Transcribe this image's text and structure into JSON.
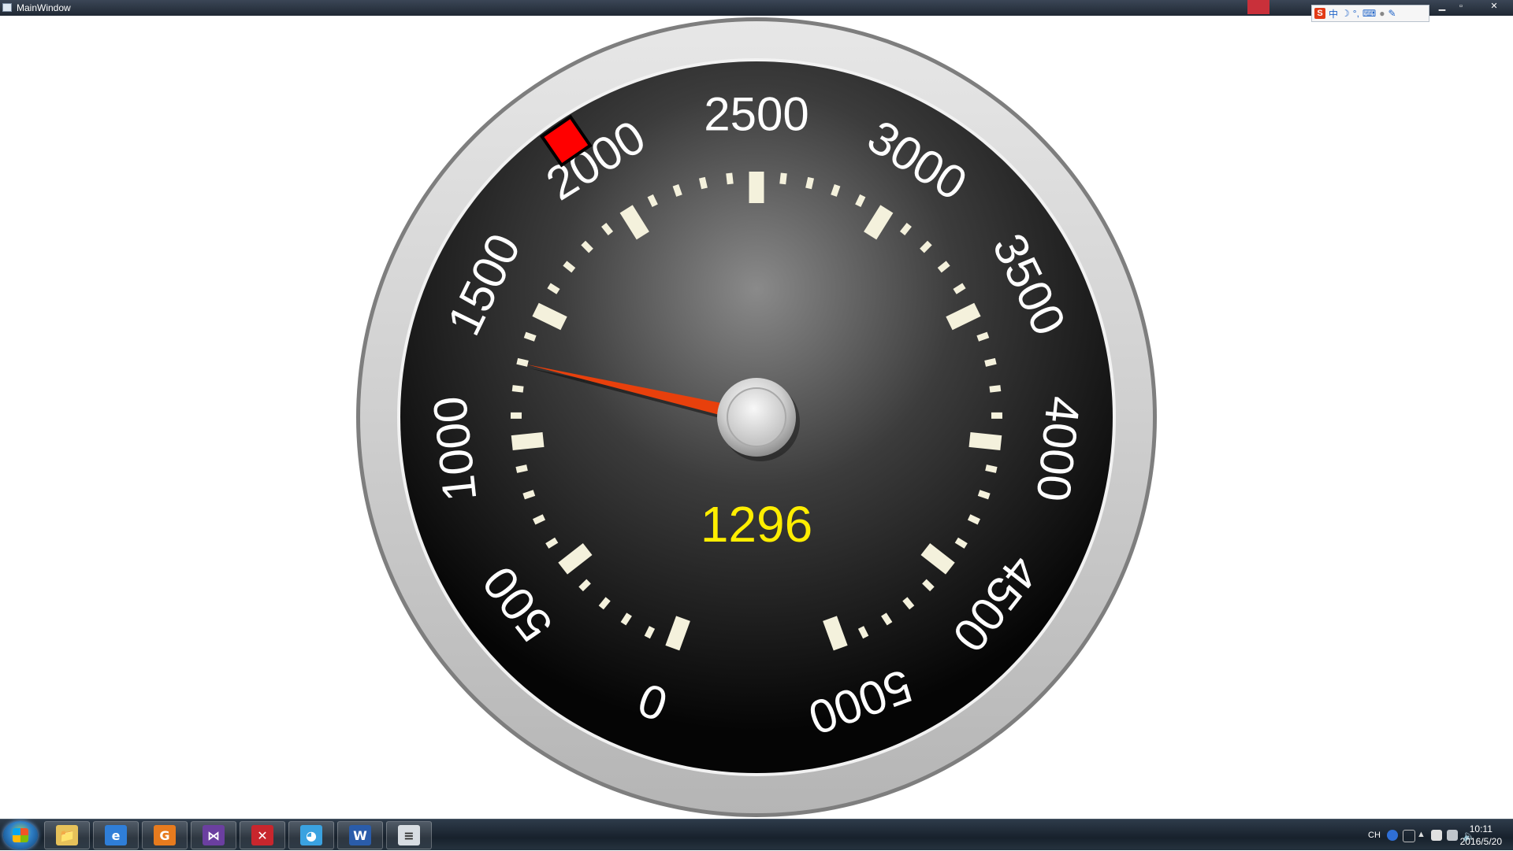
{
  "window": {
    "title": "MainWindow",
    "controls": {
      "minimize": "▁",
      "maximize": "▫",
      "close": "✕"
    }
  },
  "ime_toolbar": {
    "logo": "S",
    "mode": "中",
    "icons": [
      "moon-icon",
      "punctuation-icon",
      "keyboard-icon",
      "user-icon",
      "wrench-icon"
    ]
  },
  "gauge": {
    "current_value": "1296",
    "value": 1296,
    "min": 0,
    "max": 5000,
    "major_step": 500,
    "major_labels": [
      "0",
      "500",
      "1000",
      "1500",
      "2000",
      "2500",
      "3000",
      "3500",
      "4000",
      "4500",
      "5000"
    ],
    "colors": {
      "needle": "#e8400c",
      "readout": "#ffee00",
      "marker": "#ff0000",
      "ticks": "#f4f1dc",
      "labels": "#ffffff"
    }
  },
  "taskbar": {
    "apps": [
      {
        "name": "file-explorer-icon",
        "glyph": "📁"
      },
      {
        "name": "internet-explorer-icon",
        "glyph": "e"
      },
      {
        "name": "foxit-pdf-icon",
        "glyph": "G"
      },
      {
        "name": "visual-studio-icon",
        "glyph": "⋈"
      },
      {
        "name": "xmind-icon",
        "glyph": "✕"
      },
      {
        "name": "chat-app-icon",
        "glyph": "◕"
      },
      {
        "name": "word-icon",
        "glyph": "W"
      },
      {
        "name": "notepad-icon",
        "glyph": "≡"
      }
    ],
    "tray": {
      "language": "CH",
      "time": "10:11",
      "date": "2016/5/20"
    }
  }
}
